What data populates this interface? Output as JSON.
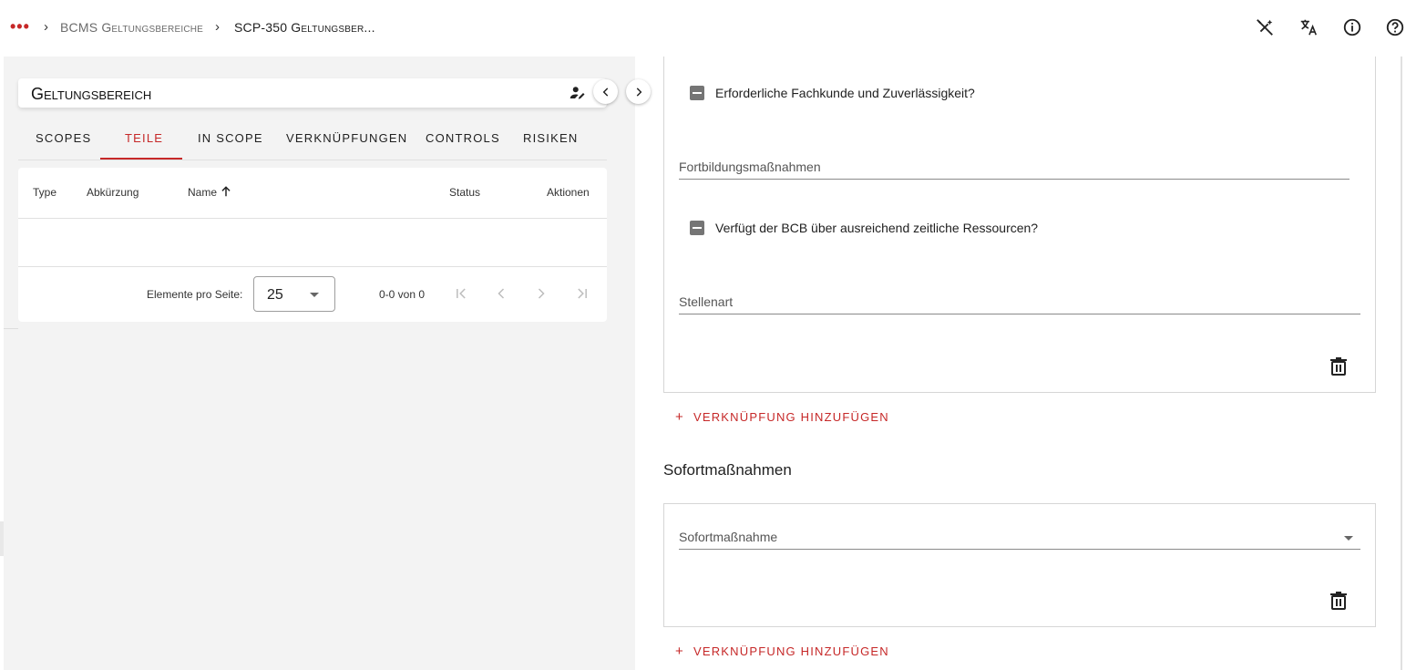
{
  "topbar": {
    "menu_dots": "•••",
    "breadcrumb": [
      "BCMS Geltungsbereiche",
      "SCP-350 Geltungsber..."
    ],
    "icons": [
      "auto-fix-off-icon",
      "translate-icon",
      "info-icon",
      "help-icon"
    ]
  },
  "left_panel": {
    "title": "Geltungsbereich",
    "tabs": [
      {
        "label": "SCOPES",
        "active": false
      },
      {
        "label": "TEILE",
        "active": true
      },
      {
        "label": "IN SCOPE",
        "active": false
      },
      {
        "label": "VERKNÜPFUNGEN",
        "active": false
      },
      {
        "label": "CONTROLS",
        "active": false
      },
      {
        "label": "RISIKEN",
        "active": false
      }
    ],
    "table": {
      "columns": [
        "Type",
        "Abkürzung",
        "Name",
        "Status",
        "Aktionen"
      ],
      "sorted_column": "Name",
      "rows": []
    },
    "paginator": {
      "items_per_page_label": "Elemente pro Seite:",
      "items_per_page_value": "25",
      "range_label": "0-0 von 0"
    }
  },
  "right_panel": {
    "link_card": {
      "checkbox1": "Erforderliche Fachkunde und Zuverlässigkeit?",
      "field1": "Fortbildungsmaßnahmen",
      "checkbox2": "Verfügt der BCB über ausreichend zeitliche Ressourcen?",
      "field2": "Stellenart"
    },
    "add_link_label": "VERKNÜPFUNG HINZUFÜGEN",
    "section_title": "Sofortmaßnahmen",
    "sofort_card": {
      "select_label": "Sofortmaßnahme"
    },
    "add_link_label_2": "VERKNÜPFUNG HINZUFÜGEN"
  },
  "colors": {
    "accent": "#c62828",
    "panel_bg": "#f3f3f3"
  }
}
